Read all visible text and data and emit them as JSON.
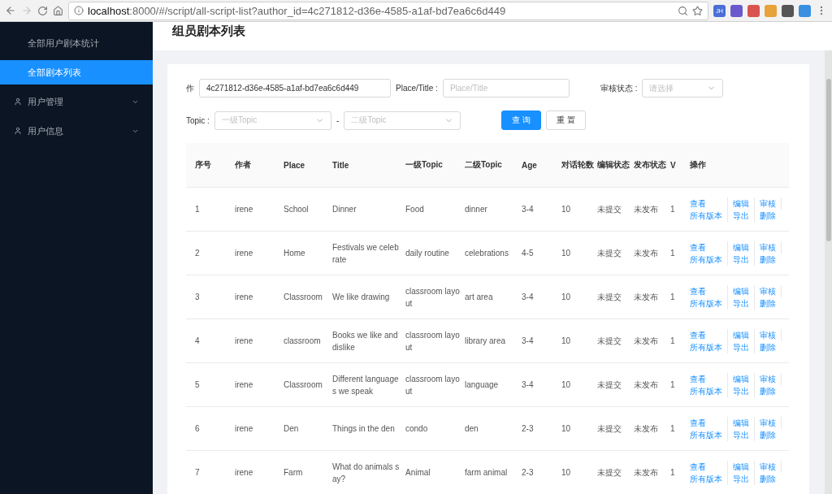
{
  "browser": {
    "url_host": "localhost",
    "url_rest": ":8000/#/script/all-script-list?author_id=4c271812-d36e-4585-a1af-bd7ea6c6d449",
    "extensions": [
      {
        "label": "JH",
        "color": "#4a6fd6"
      },
      {
        "color": "#6a5acd"
      },
      {
        "color": "#d9534f"
      },
      {
        "color": "#e8a23a"
      },
      {
        "color": "#555555"
      },
      {
        "color": "#3b8fe0"
      }
    ]
  },
  "sidebar": {
    "items": [
      {
        "label": "全部用户剧本统计",
        "kind": "sub",
        "selected": false
      },
      {
        "label": "全部剧本列表",
        "kind": "sub",
        "selected": true
      },
      {
        "label": "用户管理",
        "kind": "group",
        "selected": false
      },
      {
        "label": "用户信息",
        "kind": "group",
        "selected": false
      }
    ]
  },
  "page_title": "组员剧本列表",
  "filters": {
    "author_label": "作",
    "author_value": "4c271812-d36e-4585-a1af-bd7ea6c6d449",
    "place_label": "Place/Title :",
    "place_placeholder": "Place/Title",
    "status_label": "审核状态 :",
    "status_placeholder": "请选择",
    "topic_label": "Topic :",
    "topic1_placeholder": "一级Topic",
    "dash": "-",
    "topic2_placeholder": "二级Topic",
    "search_button": "查 询",
    "reset_button": "重 置"
  },
  "table": {
    "columns": [
      "序号",
      "作者",
      "Place",
      "Title",
      "一级Topic",
      "二级Topic",
      "Age",
      "对话轮数",
      "编辑状态",
      "发布状态",
      "V",
      "操作"
    ],
    "rows": [
      {
        "cells": [
          "1",
          "irene",
          "School",
          "Dinner",
          "Food",
          "dinner",
          "3-4",
          "10",
          "未提交",
          "未发布",
          "1"
        ],
        "actions": [
          "查看",
          "编辑",
          "审核",
          "所有版本",
          "导出",
          "删除"
        ]
      },
      {
        "cells": [
          "2",
          "irene",
          "Home",
          "Festivals we celebrate",
          "daily routine",
          "celebrations",
          "4-5",
          "10",
          "未提交",
          "未发布",
          "1"
        ],
        "actions": [
          "查看",
          "编辑",
          "审核",
          "所有版本",
          "导出",
          "删除"
        ]
      },
      {
        "cells": [
          "3",
          "irene",
          "Classroom",
          "We like drawing",
          "classroom layout",
          "art area",
          "3-4",
          "10",
          "未提交",
          "未发布",
          "1"
        ],
        "actions": [
          "查看",
          "编辑",
          "审核",
          "所有版本",
          "导出",
          "删除"
        ]
      },
      {
        "cells": [
          "4",
          "irene",
          "classroom",
          "Books we like and dislike",
          "classroom layout",
          "library area",
          "3-4",
          "10",
          "未提交",
          "未发布",
          "1"
        ],
        "actions": [
          "查看",
          "编辑",
          "审核",
          "所有版本",
          "导出",
          "删除"
        ]
      },
      {
        "cells": [
          "5",
          "irene",
          "Classroom",
          "Different languages we speak",
          "classroom layout",
          "language",
          "3-4",
          "10",
          "未提交",
          "未发布",
          "1"
        ],
        "actions": [
          "查看",
          "编辑",
          "审核",
          "所有版本",
          "导出",
          "删除"
        ]
      },
      {
        "cells": [
          "6",
          "irene",
          "Den",
          "Things in the den",
          "condo",
          "den",
          "2-3",
          "10",
          "未提交",
          "未发布",
          "1"
        ],
        "actions": [
          "查看",
          "编辑",
          "审核",
          "所有版本",
          "导出",
          "删除"
        ]
      },
      {
        "cells": [
          "7",
          "irene",
          "Farm",
          "What do animals say?",
          "Animal",
          "farm animal",
          "2-3",
          "10",
          "未提交",
          "未发布",
          "1"
        ],
        "actions": [
          "查看",
          "编辑",
          "审核",
          "所有版本",
          "导出",
          "删除"
        ]
      }
    ]
  }
}
